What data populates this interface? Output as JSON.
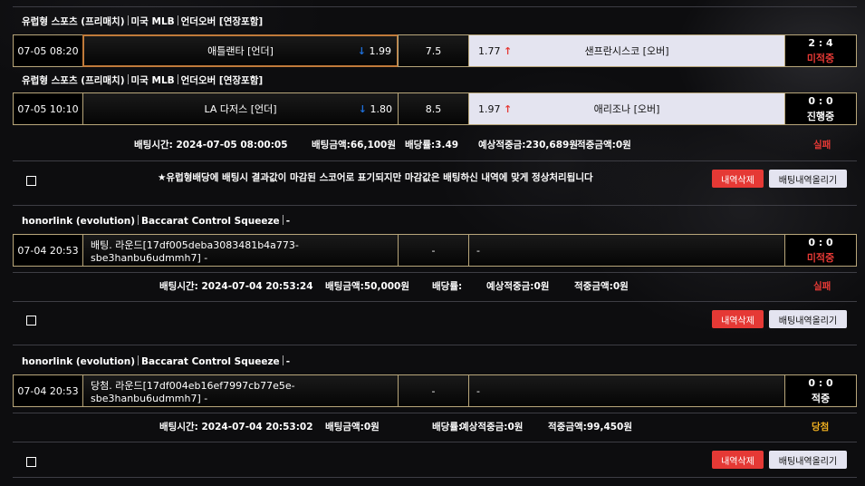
{
  "bets": [
    {
      "header": {
        "sport": "유럽형 스포츠 (프리매치)",
        "league": "미국 MLB",
        "market": "언더오버 [연장포함]"
      },
      "rows": [
        {
          "datetime": "07-05 08:20",
          "home": "애틀랜타 [언더]",
          "home_odds": "1.99",
          "home_arrow": "↓",
          "line": "7.5",
          "away_odds": "1.77",
          "away_arrow": "↑",
          "away": "샌프란시스코 [오버]",
          "score": "2 : 4",
          "status": "미적중"
        }
      ]
    },
    {
      "header": {
        "sport": "유럽형 스포츠 (프리매치)",
        "league": "미국 MLB",
        "market": "언더오버 [연장포함]"
      },
      "rows": [
        {
          "datetime": "07-05 10:10",
          "home": "LA 다저스 [언더]",
          "home_odds": "1.80",
          "home_arrow": "↓",
          "line": "8.5",
          "away_odds": "1.97",
          "away_arrow": "↑",
          "away": "애리조나 [오버]",
          "score": "0 : 0",
          "status": "진행중"
        }
      ],
      "summary": {
        "time": "배팅시간: 2024-07-05 08:00:05",
        "amount": "배팅금액:66,100원",
        "odds": "배당률:3.49",
        "expected": "예상적중금:230,689원",
        "won": "적중금액:0원",
        "result": "실패"
      },
      "notice": "★유럽형배당에 배팅시 결과값이 마감된 스코어로 표기되지만 마감값은 배팅하신 내역에 맞게 정상처리됩니다"
    },
    {
      "header": {
        "sport": "honorlink (evolution)",
        "league": "Baccarat Control Squeeze",
        "market": "-"
      },
      "rows": [
        {
          "datetime": "07-04 20:53",
          "home": "배팅. 라운드[17df005deba3083481b4a773-sbe3hanbu6udmmh7] -",
          "line": "-",
          "away": "-",
          "score": "0 : 0",
          "status": "미적중"
        }
      ],
      "summary": {
        "time": "배팅시간: 2024-07-04 20:53:24",
        "amount": "배팅금액:50,000원",
        "odds": "배당률:",
        "expected": "예상적중금:0원",
        "won": "적중금액:0원",
        "result": "실패"
      }
    },
    {
      "header": {
        "sport": "honorlink (evolution)",
        "league": "Baccarat Control Squeeze",
        "market": "-"
      },
      "rows": [
        {
          "datetime": "07-04 20:53",
          "home": "당첨. 라운드[17df004eb16ef7997cb77e5e-sbe3hanbu6udmmh7] -",
          "line": "-",
          "away": "-",
          "score": "0 : 0",
          "status": "적중"
        }
      ],
      "summary": {
        "time": "배팅시간: 2024-07-04 20:53:02",
        "amount": "배팅금액:0원",
        "odds": "배당률:",
        "expected": "예상적중금:0원",
        "won": "적중금액:99,450원",
        "result": "당첨"
      }
    }
  ],
  "buttons": {
    "delete": "내역삭제",
    "upload": "배팅내역올리기"
  },
  "colors": {
    "lose": "#e53935",
    "win": "#f0b020",
    "accent_border": "#b8a67a",
    "selected_border": "#c07a3a",
    "odds_down": "#1e6fd9",
    "odds_up": "#e53935"
  }
}
